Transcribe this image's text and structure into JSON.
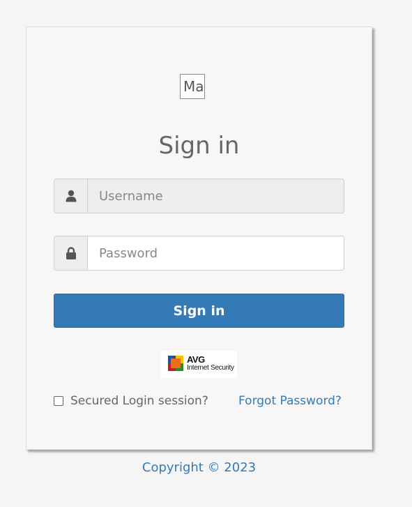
{
  "logo": {
    "text": "Ma"
  },
  "heading": "Sign in",
  "username": {
    "placeholder": "Username",
    "value": "",
    "icon": "user-icon"
  },
  "password": {
    "placeholder": "Password",
    "value": "",
    "icon": "lock-icon"
  },
  "submit_label": "Sign in",
  "security_badge": {
    "brand": "AVG",
    "product": "Internet Security"
  },
  "secured_login": {
    "label": "Secured Login session?",
    "checked": false
  },
  "forgot_password": "Forgot Password?",
  "copyright": "Copyright © 2023",
  "colors": {
    "primary": "#337ab7",
    "card_bg": "#f7f7f7",
    "page_bg": "#f5f5f5",
    "heading_text": "#666666"
  }
}
